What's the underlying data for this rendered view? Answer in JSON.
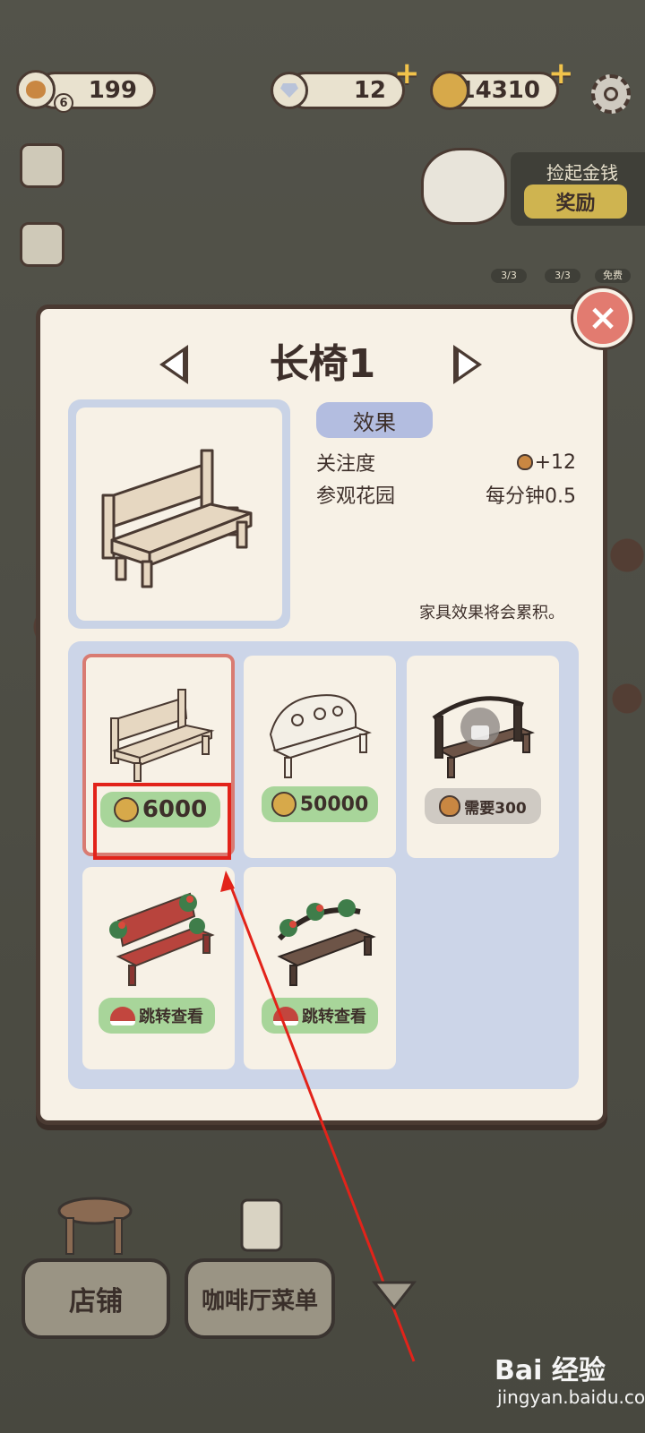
{
  "topbar": {
    "hearts": "199",
    "hearts_level": "6",
    "gems": "12",
    "coins": "14310"
  },
  "reward": {
    "title": "捡起金钱",
    "button": "奖励",
    "slots": [
      "3/3",
      "3/3",
      "免费"
    ]
  },
  "modal": {
    "title": "长椅1",
    "effect_label": "效果",
    "effects": [
      {
        "name": "关注度",
        "value": "+12"
      },
      {
        "name": "参观花园",
        "value": "每分钟0.5"
      }
    ],
    "note": "家具效果将会累积。",
    "options": [
      {
        "price": "6000",
        "type": "coin",
        "selected": true
      },
      {
        "price": "50000",
        "type": "coin",
        "selected": false
      },
      {
        "price": "需要300",
        "type": "heart",
        "selected": false,
        "locked": true
      },
      {
        "price": "跳转查看",
        "type": "hat",
        "selected": false
      },
      {
        "price": "跳转查看",
        "type": "hat",
        "selected": false
      }
    ]
  },
  "bottom": {
    "shop": "店铺",
    "menu": "咖啡厅菜单"
  },
  "watermark": {
    "brand": "Bai 经验",
    "url": "jingyan.baidu.com"
  },
  "colors": {
    "accent_red": "#e2231a",
    "price_green": "#a8d59a",
    "effect_chip": "#b3bde0"
  }
}
